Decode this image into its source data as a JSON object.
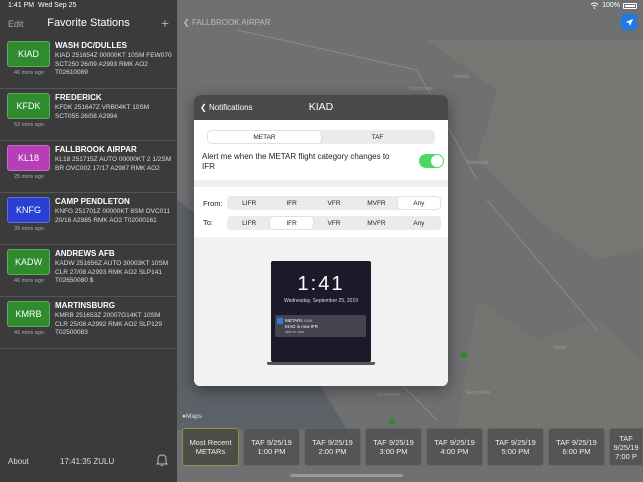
{
  "status_bar": {
    "time": "1:41 PM",
    "date": "Wed Sep 25",
    "battery": "100%"
  },
  "sidebar": {
    "edit_label": "Edit",
    "title": "Favorite Stations",
    "add_label": "+",
    "stations": [
      {
        "code": "KIAD",
        "color": "#2e8b2e",
        "ago": "46 mins ago",
        "name": "WASH DC/DULLES",
        "metar": "KIAD 251654Z 00000KT 10SM FEW070 SCT250 26/09 A2993 RMK AO2 T02610089"
      },
      {
        "code": "KFDK",
        "color": "#2e8b2e",
        "ago": "53 mins ago",
        "name": "FREDERICK",
        "metar": "KFDK 251647Z VRB04KT 10SM SCT055 26/08 A2994"
      },
      {
        "code": "KL18",
        "color": "#b63eb6",
        "ago": "25 mins ago",
        "name": "FALLBROOK AIRPAR",
        "metar": "KL18 251715Z AUTO 00000KT 2 1/2SM BR OVC002 17/17 A2987 RMK AO2"
      },
      {
        "code": "KNFG",
        "color": "#2a3fd4",
        "ago": "39 mins ago",
        "name": "CAMP PENDLETON",
        "metar": "KNFG 251701Z 00000KT 8SM OVC011 20/16 A2985 RMK AO2 T02000161"
      },
      {
        "code": "KADW",
        "color": "#2e8b2e",
        "ago": "46 mins ago",
        "name": "ANDREWS AFB",
        "metar": "KADW 251656Z AUTO 30003KT 10SM CLR 27/08 A2993 RMK AO2 SLP141 T02650080 $"
      },
      {
        "code": "KMRB",
        "color": "#2e8b2e",
        "ago": "46 mins ago",
        "name": "MARTINSBURG",
        "metar": "KMRB 251653Z 20007G14KT 10SM CLR 25/08 A2992 RMK AO2 SLP129 T02500083"
      }
    ],
    "footer": {
      "about": "About",
      "clock": "17:41:35 ZULU"
    }
  },
  "map": {
    "back_label": "FALLBROOK AIRPAR",
    "credit": "Maps",
    "towns": [
      "Hemet",
      "Winchester",
      "Temecula",
      "Escondido",
      "Julian",
      "Oceanside"
    ]
  },
  "modal": {
    "back_label": "Notifications",
    "title": "KIAD",
    "product_tabs": [
      "METAR",
      "TAF"
    ],
    "alert_text": "Alert me when the METAR flight category changes to IFR",
    "from_label": "From:",
    "to_label": "To:",
    "categories": [
      "LIFR",
      "IFR",
      "VFR",
      "MVFR",
      "Any"
    ],
    "preview": {
      "clock": "1:41",
      "date": "Wednesday, September 25, 2019",
      "app": "METARs",
      "when": "now",
      "message": "KIAD is now IFR",
      "hint": "slide to view"
    }
  },
  "forecast": {
    "items": [
      {
        "line1": "Most Recent",
        "line2": "METARs"
      },
      {
        "line1": "TAF 9/25/19",
        "line2": "1:00 PM"
      },
      {
        "line1": "TAF 9/25/19",
        "line2": "2:00 PM"
      },
      {
        "line1": "TAF 9/25/19",
        "line2": "3:00 PM"
      },
      {
        "line1": "TAF 9/25/19",
        "line2": "4:00 PM"
      },
      {
        "line1": "TAF 9/25/19",
        "line2": "5:00 PM"
      },
      {
        "line1": "TAF 9/25/19",
        "line2": "6:00 PM"
      },
      {
        "line1": "TAF 9/25/19",
        "line2": "7:00 P"
      }
    ]
  }
}
